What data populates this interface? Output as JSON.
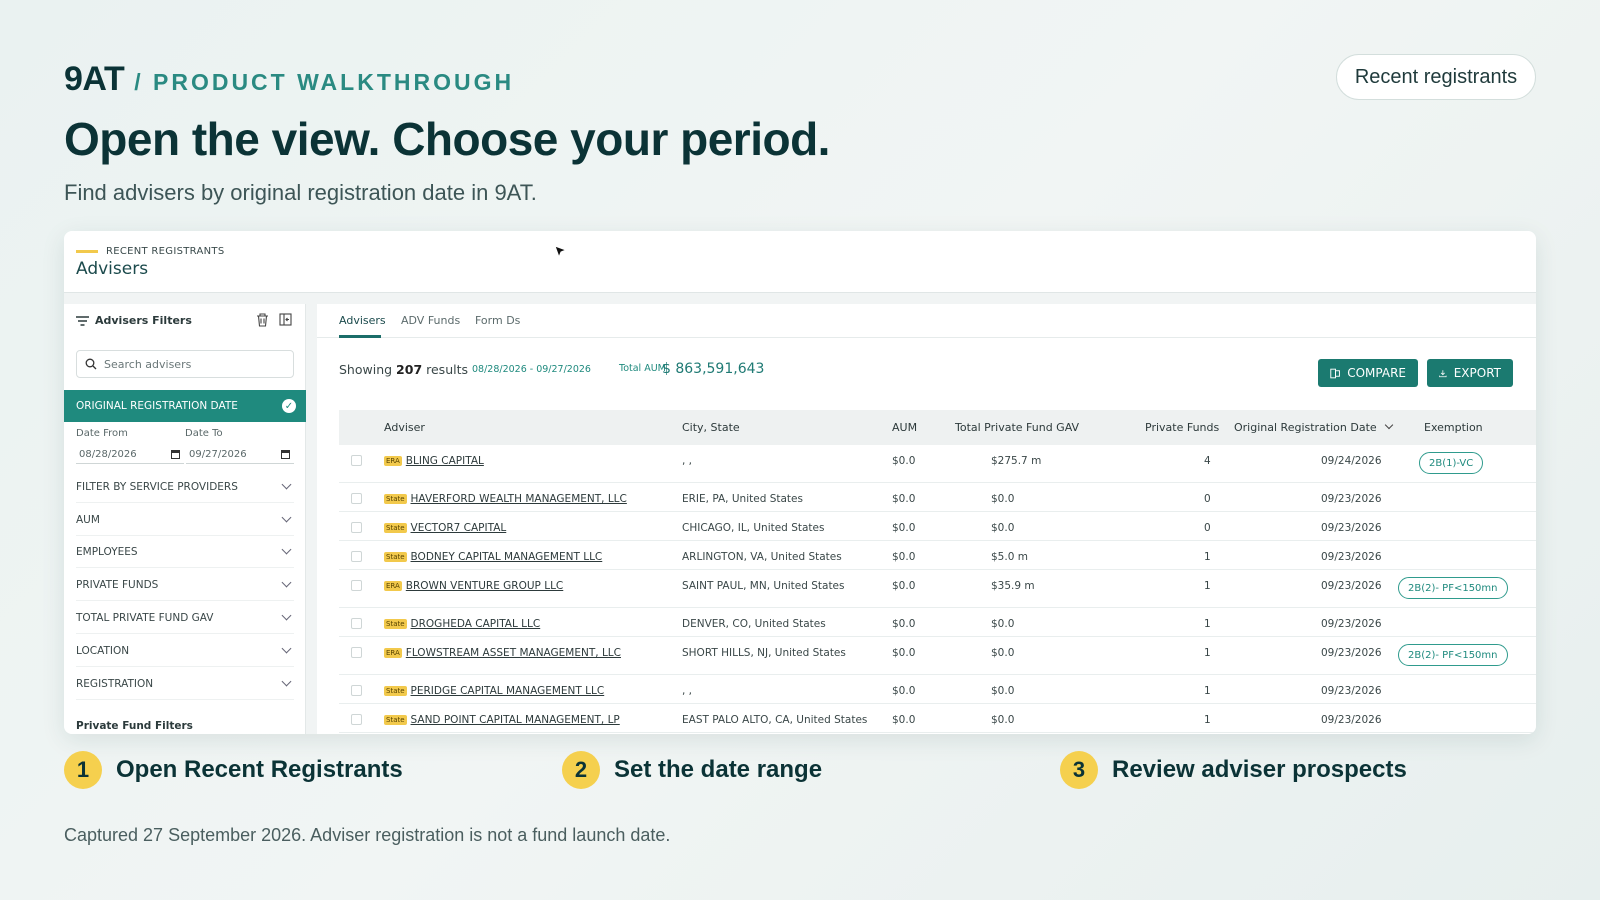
{
  "brand": {
    "logo": "9AT",
    "section": "/ PRODUCT WALKTHROUGH"
  },
  "top_button": "Recent registrants",
  "headline": "Open the view. Choose your period.",
  "subhead": "Find advisers by original registration date in 9AT.",
  "card": {
    "eyebrow": "RECENT REGISTRANTS",
    "title": "Advisers",
    "filters": {
      "title": "Advisers Filters",
      "search_placeholder": "Search advisers",
      "active_filter": "ORIGINAL REGISTRATION DATE",
      "date_from_label": "Date From",
      "date_to_label": "Date To",
      "date_from": "08/28/2026",
      "date_to": "09/27/2026",
      "facets": [
        "FILTER BY SERVICE PROVIDERS",
        "AUM",
        "EMPLOYEES",
        "PRIVATE FUNDS",
        "TOTAL PRIVATE FUND GAV",
        "LOCATION",
        "REGISTRATION"
      ],
      "private_fund_filters": "Private Fund Filters"
    },
    "tabs": [
      "Advisers",
      "ADV Funds",
      "Form Ds"
    ],
    "summary": {
      "showing_prefix": "Showing",
      "count": "207",
      "showing_suffix": "results",
      "range": "08/28/2026 - 09/27/2026",
      "aum_label": "Total AUM",
      "aum_value": "$ 863,591,643"
    },
    "buttons": {
      "compare": "COMPARE",
      "export": "EXPORT"
    },
    "columns": [
      "Adviser",
      "City, State",
      "AUM",
      "Total Private Fund GAV",
      "Private Funds",
      "Original Registration Date",
      "Exemption"
    ],
    "rows": [
      {
        "badge": "ERA",
        "adviser": "BLING CAPITAL",
        "city": ", ,",
        "aum": "$0.0",
        "gav": "$275.7 m",
        "funds": "4",
        "date": "09/24/2026",
        "exemption": "2B(1)-VC"
      },
      {
        "badge": "State",
        "adviser": "HAVERFORD WEALTH MANAGEMENT, LLC",
        "city": "ERIE, PA, United States",
        "aum": "$0.0",
        "gav": "$0.0",
        "funds": "0",
        "date": "09/23/2026",
        "exemption": ""
      },
      {
        "badge": "State",
        "adviser": "VECTOR7 CAPITAL",
        "city": "CHICAGO, IL, United States",
        "aum": "$0.0",
        "gav": "$0.0",
        "funds": "0",
        "date": "09/23/2026",
        "exemption": ""
      },
      {
        "badge": "State",
        "adviser": "BODNEY CAPITAL MANAGEMENT LLC",
        "city": "ARLINGTON, VA, United States",
        "aum": "$0.0",
        "gav": "$5.0 m",
        "funds": "1",
        "date": "09/23/2026",
        "exemption": ""
      },
      {
        "badge": "ERA",
        "adviser": "BROWN VENTURE GROUP LLC",
        "city": "SAINT PAUL, MN, United States",
        "aum": "$0.0",
        "gav": "$35.9 m",
        "funds": "1",
        "date": "09/23/2026",
        "exemption": "2B(2)- PF<150mn"
      },
      {
        "badge": "State",
        "adviser": "DROGHEDA CAPITAL LLC",
        "city": "DENVER, CO, United States",
        "aum": "$0.0",
        "gav": "$0.0",
        "funds": "1",
        "date": "09/23/2026",
        "exemption": ""
      },
      {
        "badge": "ERA",
        "adviser": "FLOWSTREAM ASSET MANAGEMENT, LLC",
        "city": "SHORT HILLS, NJ, United States",
        "aum": "$0.0",
        "gav": "$0.0",
        "funds": "1",
        "date": "09/23/2026",
        "exemption": "2B(2)- PF<150mn"
      },
      {
        "badge": "State",
        "adviser": "PERIDGE CAPITAL MANAGEMENT LLC",
        "city": ", ,",
        "aum": "$0.0",
        "gav": "$0.0",
        "funds": "1",
        "date": "09/23/2026",
        "exemption": ""
      },
      {
        "badge": "State",
        "adviser": "SAND POINT CAPITAL MANAGEMENT, LP",
        "city": "EAST PALO ALTO, CA, United States",
        "aum": "$0.0",
        "gav": "$0.0",
        "funds": "1",
        "date": "09/23/2026",
        "exemption": ""
      }
    ]
  },
  "steps": [
    {
      "num": "1",
      "label": "Open Recent Registrants"
    },
    {
      "num": "2",
      "label": "Set the date range"
    },
    {
      "num": "3",
      "label": "Review adviser prospects"
    }
  ],
  "footnote": "Captured 27 September 2026. Adviser registration is not a fund launch date.",
  "colors": {
    "accent": "#1f8a7e",
    "brand_dark": "#0b3336",
    "badge_yellow": "#f2c94c"
  }
}
